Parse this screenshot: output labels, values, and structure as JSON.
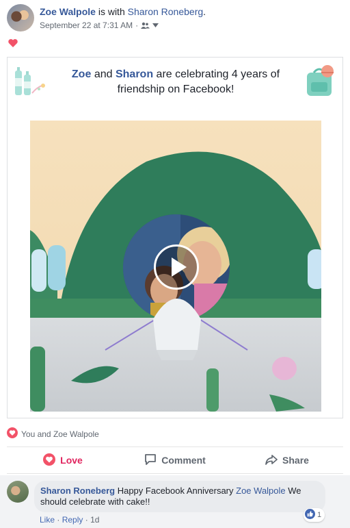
{
  "post": {
    "author": "Zoe Walpole",
    "with_text": "is with",
    "tagged": "Sharon Roneberg",
    "tagged_suffix": ".",
    "timestamp": "September 22 at 7:31 AM",
    "separator": "·",
    "privacy_icon": "friends-icon"
  },
  "card": {
    "name1": "Zoe",
    "and": "and",
    "name2": "Sharon",
    "message": "are celebrating 4 years of friendship on Facebook!"
  },
  "reactions": {
    "summary": "You and Zoe Walpole",
    "icon": "heart-icon"
  },
  "actions": {
    "love": "Love",
    "comment": "Comment",
    "share": "Share"
  },
  "comment": {
    "author": "Sharon Roneberg",
    "text_before": "Happy Facebook Anniversary",
    "mention": "Zoe Walpole",
    "text_after": "We should celebrate with cake!!",
    "like_count": "1",
    "like": "Like",
    "reply": "Reply",
    "dot": "·",
    "age": "1d"
  },
  "colors": {
    "link": "#365899",
    "love": "#e0245e",
    "muted": "#606770"
  }
}
